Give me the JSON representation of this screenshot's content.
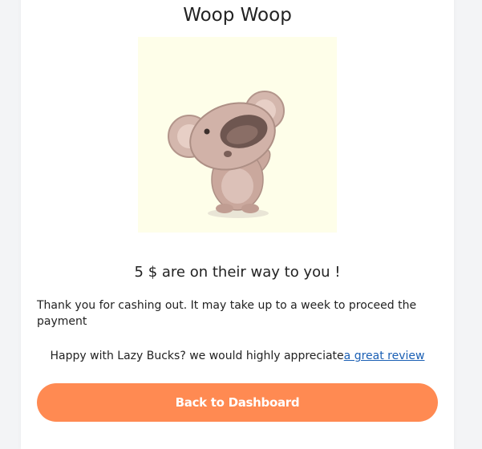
{
  "card": {
    "title": "Woop Woop",
    "illustration": "koala-cheering-illustration",
    "subtitle": "5 $ are on their way to you !",
    "thanks_text": "Thank you for cashing out. It may take up to a week to proceed the payment",
    "review": {
      "prefix": "Happy with Lazy Bucks? we would highly appreciate",
      "link_text": "a great review"
    },
    "cta_label": "Back to Dashboard"
  },
  "colors": {
    "accent": "#ff8a52",
    "link": "#1a5fb4",
    "illustration_bg": "#fefee9",
    "koala": "#c9a89e"
  }
}
